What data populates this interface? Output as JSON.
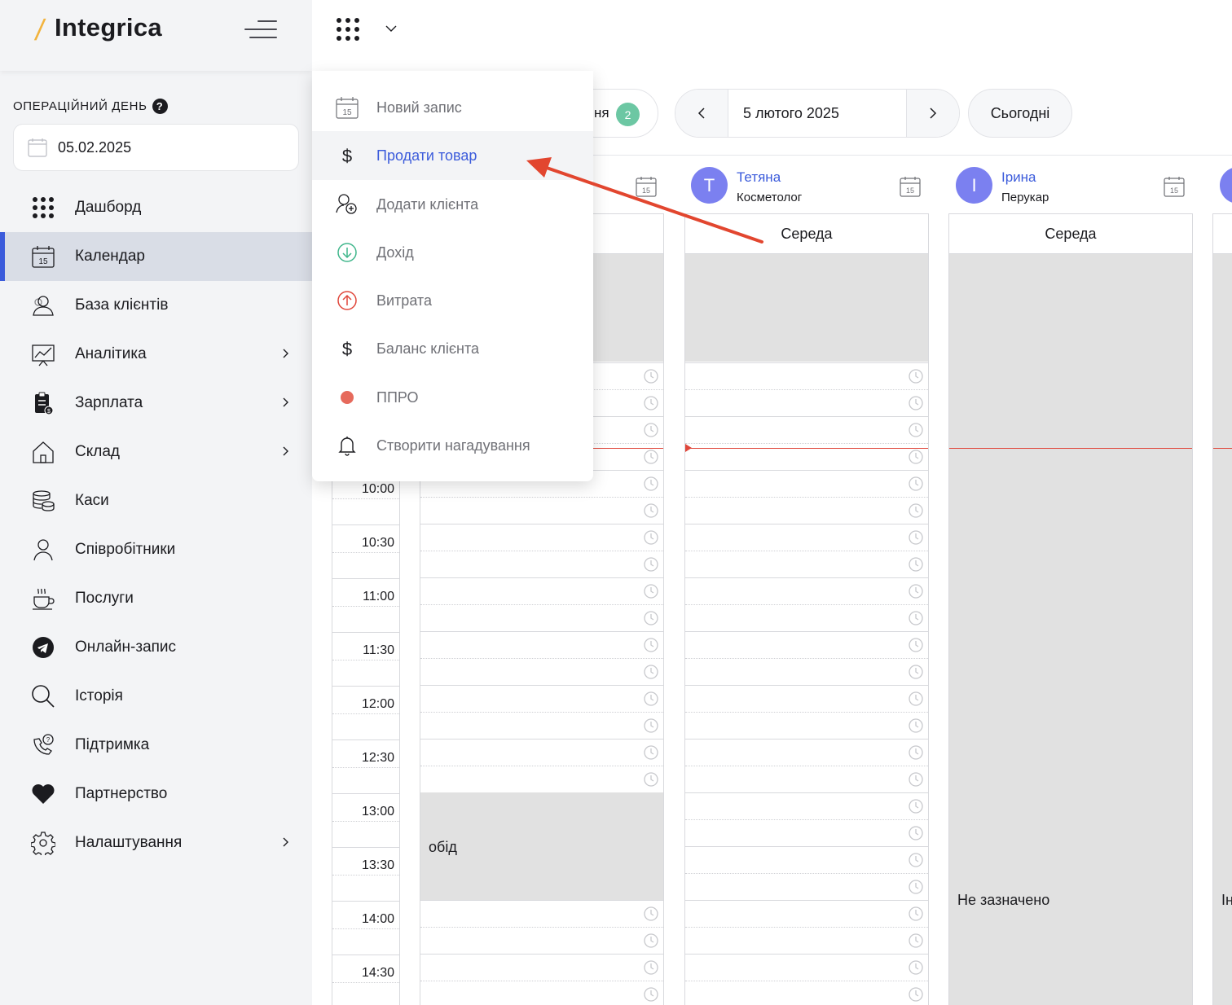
{
  "app": {
    "name": "Integrica"
  },
  "sidebar": {
    "op_day_label": "ОПЕРАЦІЙНИЙ ДЕНЬ",
    "op_day_value": "05.02.2025",
    "items": [
      {
        "label": "Дашборд",
        "icon": "grid-dots-icon"
      },
      {
        "label": "Календар",
        "icon": "calendar-icon",
        "active": true
      },
      {
        "label": "База клієнтів",
        "icon": "users-icon"
      },
      {
        "label": "Аналітика",
        "icon": "analytics-icon",
        "has_submenu": true
      },
      {
        "label": "Зарплата",
        "icon": "clipboard-money-icon",
        "has_submenu": true
      },
      {
        "label": "Склад",
        "icon": "house-icon",
        "has_submenu": true
      },
      {
        "label": "Каси",
        "icon": "coins-icon"
      },
      {
        "label": "Співробітники",
        "icon": "person-icon"
      },
      {
        "label": "Послуги",
        "icon": "coffee-cup-icon"
      },
      {
        "label": "Онлайн-запис",
        "icon": "telegram-icon"
      },
      {
        "label": "Історія",
        "icon": "search-icon"
      },
      {
        "label": "Підтримка",
        "icon": "phone-help-icon"
      },
      {
        "label": "Партнерство",
        "icon": "heart-icon"
      },
      {
        "label": "Налаштування",
        "icon": "gear-icon",
        "has_submenu": true
      }
    ]
  },
  "dropdown": {
    "items": [
      {
        "label": "Новий запис",
        "icon": "calendar-icon"
      },
      {
        "label": "Продати товар",
        "icon": "dollar-icon",
        "highlighted": true
      },
      {
        "label": "Додати клієнта",
        "icon": "add-user-icon"
      },
      {
        "label": "Дохід",
        "icon": "arrow-down-circle-icon",
        "color": "#3fb68b"
      },
      {
        "label": "Витрата",
        "icon": "arrow-up-circle-icon",
        "color": "#e0463a"
      },
      {
        "label": "Баланс клієнта",
        "icon": "dollar-icon"
      },
      {
        "label": "ППРО",
        "icon": "red-dot-icon",
        "color": "#e66a5c"
      },
      {
        "label": "Створити нагадування",
        "icon": "bell-icon"
      }
    ]
  },
  "calendar": {
    "partial_tab_text": "ня",
    "partial_tab_badge": "2",
    "current_date": "5 лютого 2025",
    "today_label": "Сьогодні",
    "times": [
      "10:00",
      "10:30",
      "11:00",
      "11:30",
      "12:00",
      "12:30",
      "13:00",
      "13:30",
      "14:00",
      "14:30"
    ],
    "staff": [
      {
        "initial": "T",
        "name": "Тетяна",
        "role": "Косметолог"
      },
      {
        "initial": "I",
        "name": "Ірина",
        "role": "Перукар"
      }
    ],
    "day_label": "Середа",
    "lunch_label": "обід",
    "unset_label": "Не зазначено",
    "cut_label": "Ін"
  },
  "colors": {
    "accent": "#3b5bdb",
    "avatar": "#7b80f0",
    "now_line": "#e0463a",
    "badge": "#6cc7a3",
    "logo_slash": "#f2b33d"
  }
}
